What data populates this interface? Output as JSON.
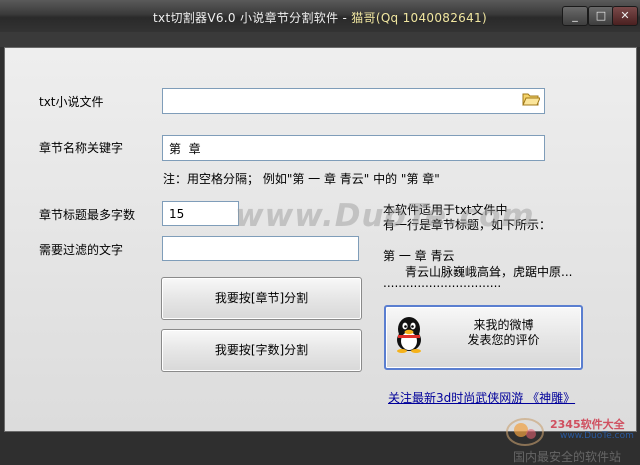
{
  "window": {
    "title_main": "txt切割器V6.0 小说章节分割软件 - ",
    "title_accent": "猫哥(Qq 1040082641)",
    "minimize_glyph": "_",
    "maximize_glyph": "□",
    "close_glyph": "✕"
  },
  "form": {
    "file_label": "txt小说文件",
    "file_value": "",
    "keyword_label": "章节名称关键字",
    "keyword_value": "第  章",
    "note": "注：用空格分隔；    例如\"第 一 章  青云\" 中的 \"第  章\"",
    "maxlen_label": "章节标题最多字数",
    "maxlen_value": "15",
    "filter_label": "需要过滤的文字",
    "filter_value": ""
  },
  "buttons": {
    "split_chapter": "我要按[章节]分割",
    "split_count": "我要按[字数]分割",
    "rate_line1": "来我的微博",
    "rate_line2": "发表您的评价"
  },
  "info": {
    "line1": "本软件适用于txt文件中",
    "line2": "有一行是章节标题，如下所示：",
    "example_title": "第 一 章   青云",
    "example_body": "青云山脉巍峨高耸，虎踞中原...",
    "dots": "..............................."
  },
  "footer": {
    "link": "关注最新3d时尚武侠网游 《神雕》"
  },
  "watermarks": {
    "main": "www.DuoTe.com",
    "corner_name": "2345软件大全",
    "corner_url": "www.DuoTe.com",
    "corner_slogan": "国内最安全的软件站"
  },
  "colors": {
    "titlebar": "#3a3a3a",
    "client_bg": "#e6e6e6",
    "link": "#00009a",
    "qq_border": "#5a7ed0"
  }
}
